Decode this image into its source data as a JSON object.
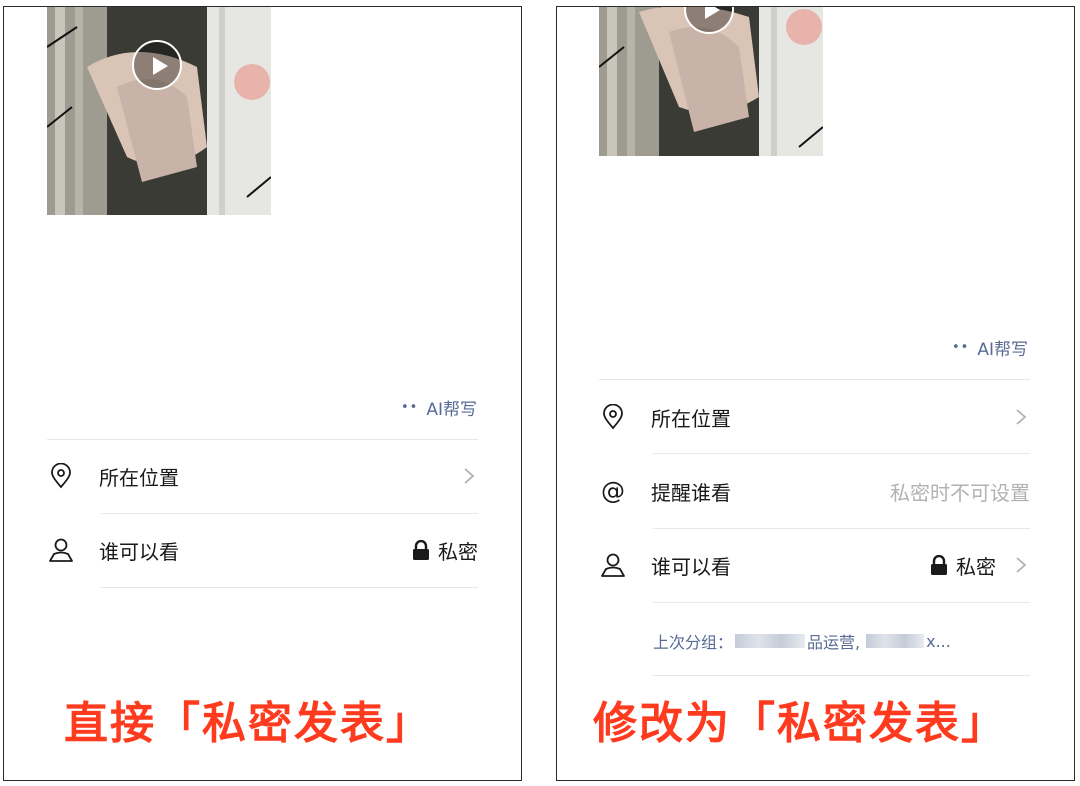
{
  "left": {
    "ai_help": "AI帮写",
    "location_label": "所在位置",
    "visibility_label": "谁可以看",
    "visibility_value": "私密",
    "caption": "直接「私密发表」"
  },
  "right": {
    "ai_help": "AI帮写",
    "location_label": "所在位置",
    "mention_label": "提醒谁看",
    "mention_value": "私密时不可设置",
    "visibility_label": "谁可以看",
    "visibility_value": "私密",
    "last_group_prefix": "上次分组：",
    "last_group_mid": "品运营,",
    "last_group_suffix": "x...",
    "caption": "修改为「私密发表」"
  },
  "icons": {
    "ai": "sparkle-dots-icon",
    "location": "location-pin-icon",
    "mention": "at-sign-icon",
    "visibility": "person-icon",
    "lock": "lock-icon",
    "chevron": "chevron-right-icon",
    "play": "play-icon"
  },
  "colors": {
    "accent_link": "#576b95",
    "caption_red": "#ff3b1f",
    "placeholder_gray": "#b2b2b2"
  }
}
